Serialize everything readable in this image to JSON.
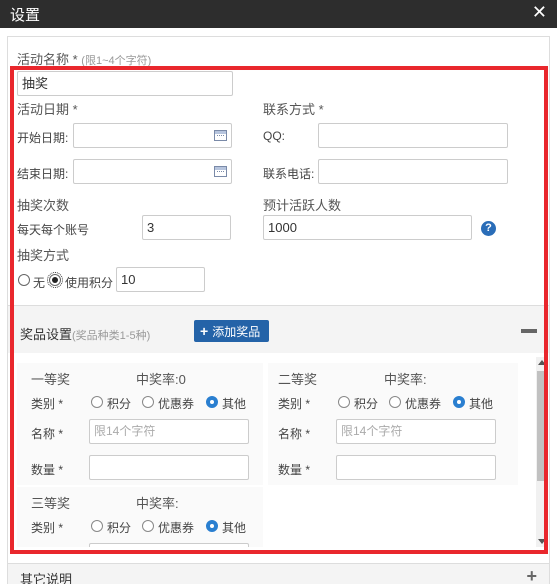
{
  "dialog": {
    "title": "设置",
    "close_icon": "✕"
  },
  "activity": {
    "name_label": "活动名称 *",
    "name_hint": "(限1~4个字符)",
    "name_value": "抽奖",
    "date_label": "活动日期 *",
    "start_label": "开始日期:",
    "end_label": "结束日期:",
    "contact_label": "联系方式 *",
    "qq_label": "QQ:",
    "phone_label": "联系电话:",
    "draws_label": "抽奖次数",
    "per_day_label": "每天每个账号",
    "per_day_value": "3",
    "active_label": "预计活跃人数",
    "active_value": "1000",
    "help_icon": "?",
    "mode_label": "抽奖方式",
    "mode_none": "无",
    "mode_points": "使用积分",
    "points_value": "10"
  },
  "prizes_section": {
    "title": "奖品设置",
    "hint": "(奖品种类1-5种)",
    "add_label": "添加奖品",
    "add_icon": "+",
    "collapse_icon": "minus-icon",
    "category_label": "类别 *",
    "name_label": "名称 *",
    "qty_label": "数量 *",
    "name_placeholder": "限14个字符",
    "options": [
      "积分",
      "优惠券",
      "其他"
    ],
    "items": [
      {
        "title": "一等奖",
        "rate": "中奖率:0"
      },
      {
        "title": "二等奖",
        "rate": "中奖率:"
      },
      {
        "title": "三等奖",
        "rate": "中奖率:"
      }
    ]
  },
  "other_section": {
    "title": "其它说明",
    "expand_icon": "+"
  },
  "accent_colors": {
    "titlebar": "#2d2d2d",
    "button": "#2463a8",
    "highlight_frame": "#e9272d"
  }
}
